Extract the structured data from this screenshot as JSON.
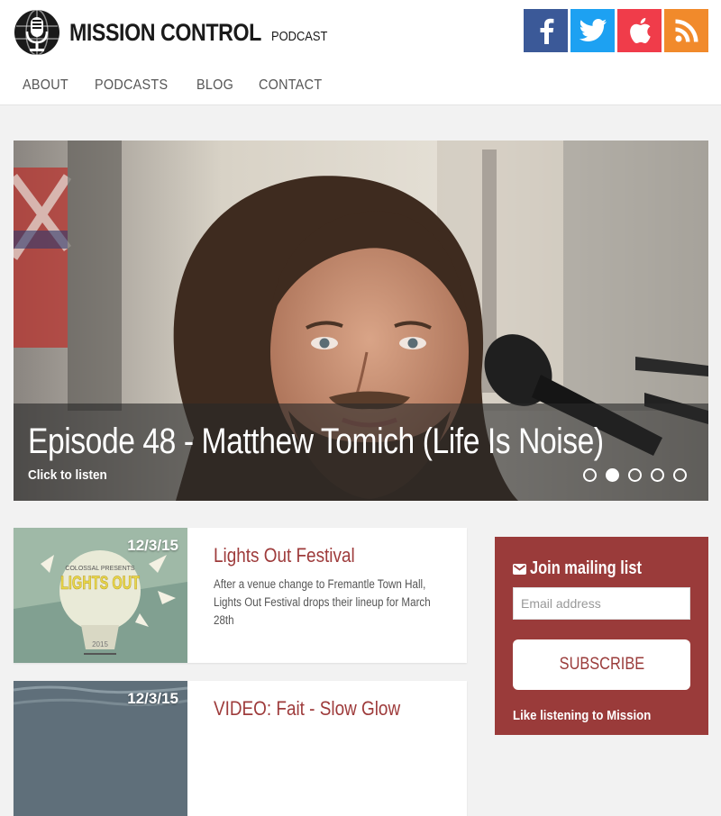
{
  "brand": {
    "name": "MISSION CONTROL",
    "sub": "PODCAST"
  },
  "social": [
    {
      "name": "facebook",
      "color": "#3b5998"
    },
    {
      "name": "twitter",
      "color": "#1da1f2"
    },
    {
      "name": "apple",
      "color": "#f03c4a"
    },
    {
      "name": "rss",
      "color": "#f18a2b"
    }
  ],
  "nav": {
    "about": "ABOUT",
    "podcasts": "PODCASTS",
    "blog": "BLOG",
    "contact": "CONTACT"
  },
  "hero": {
    "title": "Episode 48 - Matthew Tomich (Life Is Noise)",
    "subtitle": "Click to listen",
    "slides_total": 5,
    "active_slide": 2
  },
  "posts": [
    {
      "date": "12/3/15",
      "title": "Lights Out Festival",
      "excerpt": "After a venue change to Fremantle Town Hall, Lights Out Festival drops their lineup for March 28th",
      "thumb_text": {
        "top": "COLOSSAL PRESENTS",
        "main": "LIGHTS OUT",
        "year": "2015"
      }
    },
    {
      "date": "12/3/15",
      "title": "VIDEO: Fait - Slow Glow",
      "excerpt": ""
    }
  ],
  "sidebar": {
    "mailing_title": "Join mailing list",
    "email_placeholder": "Email address",
    "subscribe_label": "SUBSCRIBE",
    "listen_text": "Like listening to Mission"
  },
  "colors": {
    "accent": "#9a3b3a",
    "title_red": "#9e3b3b"
  }
}
